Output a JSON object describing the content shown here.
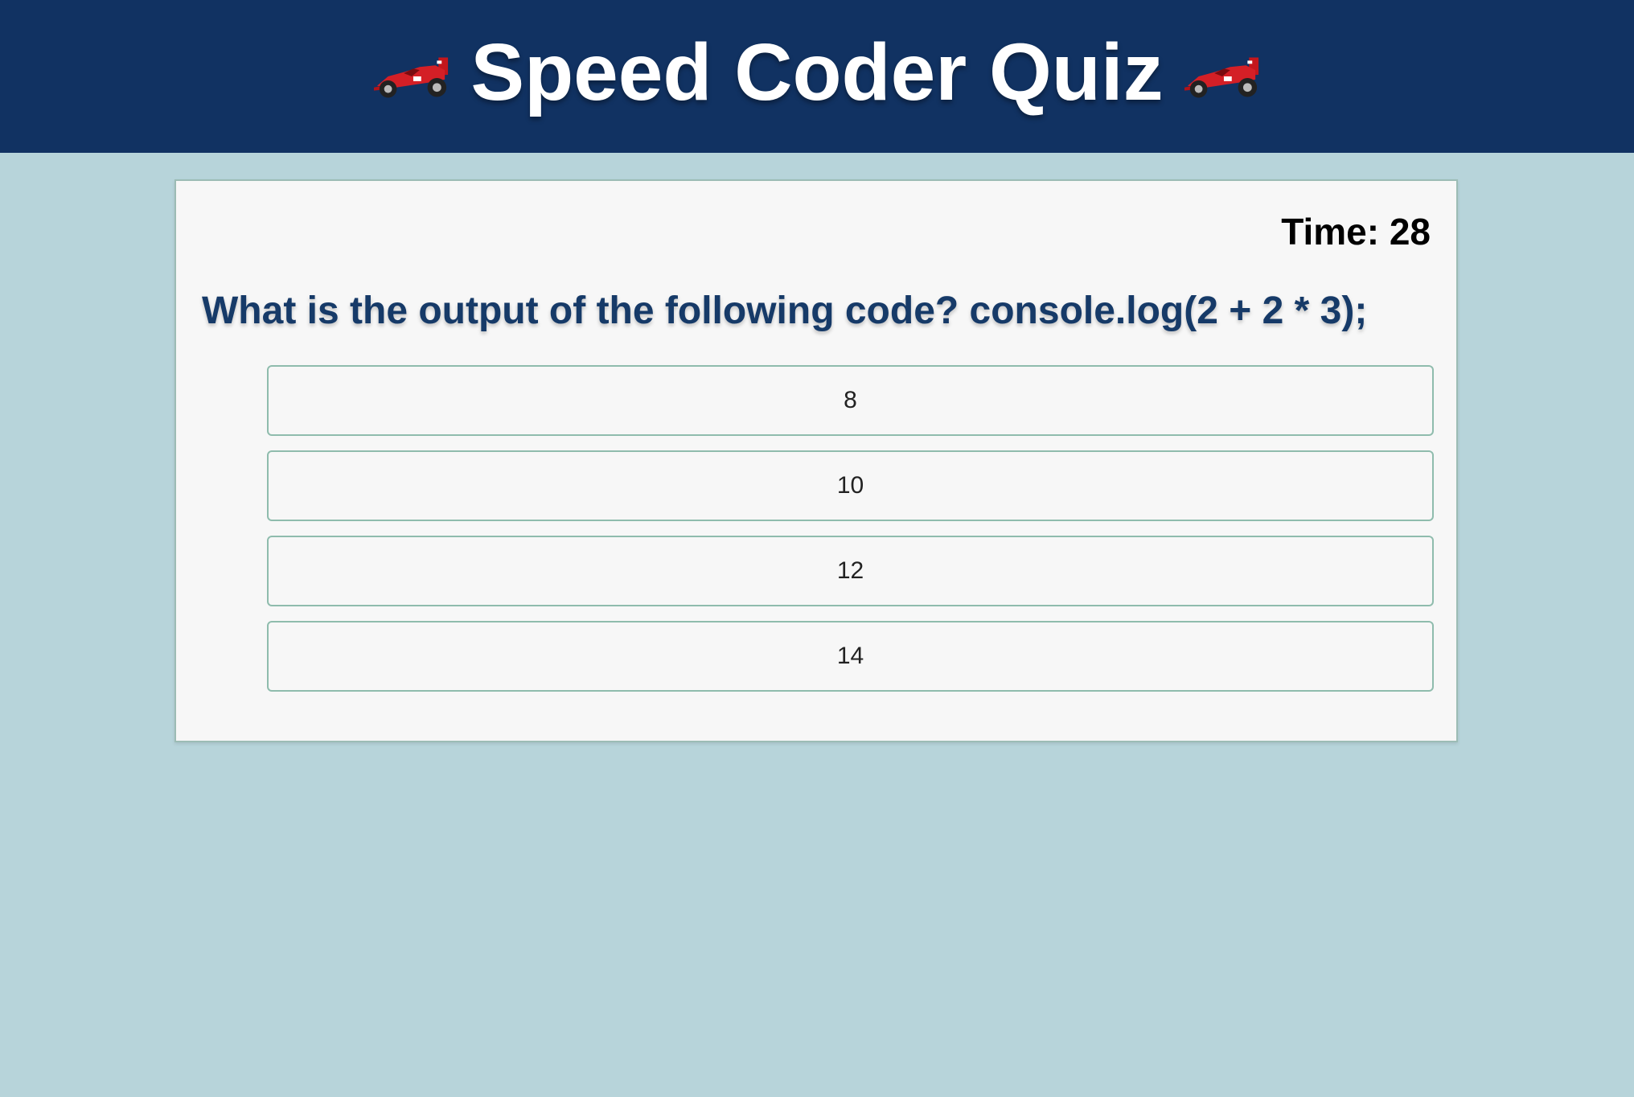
{
  "header": {
    "title": "Speed Coder Quiz",
    "left_icon": "race-car-icon",
    "right_icon": "race-car-icon",
    "background_color": "#113262"
  },
  "quiz": {
    "timer_text": "Time: 28",
    "question": "What is the output of the following code? console.log(2 + 2 * 3);",
    "answers": [
      "8",
      "10",
      "12",
      "14"
    ]
  },
  "colors": {
    "page_background": "#b7d4da",
    "card_background": "#f7f7f7",
    "question_text": "#163a68",
    "answer_border": "#8fbcad"
  }
}
